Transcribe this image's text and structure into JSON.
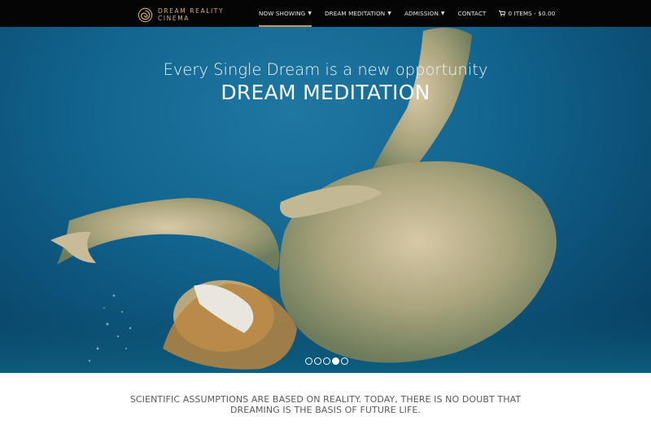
{
  "brand": {
    "line1": "DREAM REALITY",
    "line2": "CINEMA",
    "logo_icon": "spiral-logo-icon",
    "accent": "#c99a46"
  },
  "nav": {
    "items": [
      {
        "label": "NOW SHOWING",
        "has_dropdown": true,
        "active": true
      },
      {
        "label": "DREAM MEDITATION",
        "has_dropdown": true,
        "active": false
      },
      {
        "label": "ADMISSION",
        "has_dropdown": true,
        "active": false
      },
      {
        "label": "CONTACT",
        "has_dropdown": false,
        "active": false
      }
    ],
    "cart": {
      "icon": "cart-icon",
      "label": "0 ITEMS - $0.00"
    }
  },
  "hero": {
    "subtitle": "Every Single Dream is a new opportunity",
    "title": "DREAM MEDITATION",
    "image": "underwater-figure-with-sleep-mask",
    "slides": {
      "count": 5,
      "active_index": 3
    }
  },
  "tagline": {
    "line1": "SCIENTIFIC ASSUMPTIONS ARE BASED ON REALITY. TODAY, THERE IS NO DOUBT THAT",
    "line2": "DREAMING IS THE BASIS OF FUTURE LIFE."
  },
  "colors": {
    "navbar": "#050505",
    "water": "#12658f",
    "text_muted": "#5a5a5a"
  }
}
